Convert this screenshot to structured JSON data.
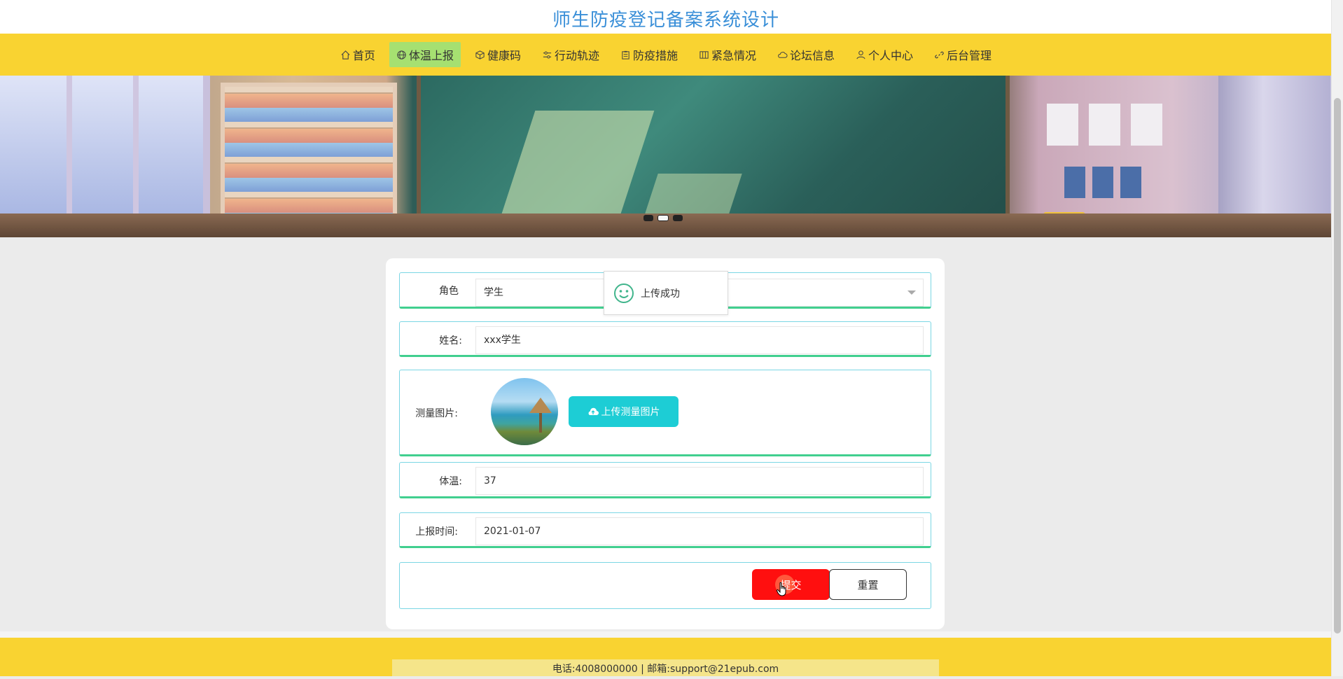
{
  "site": {
    "title": "师生防疫登记备案系统设计"
  },
  "nav": {
    "items": [
      {
        "label": "首页",
        "icon": "home-icon"
      },
      {
        "label": "体温上报",
        "icon": "globe-icon"
      },
      {
        "label": "健康码",
        "icon": "cube-icon"
      },
      {
        "label": "行动轨迹",
        "icon": "sliders-icon"
      },
      {
        "label": "防疫措施",
        "icon": "clipboard-icon"
      },
      {
        "label": "紧急情况",
        "icon": "grid-icon"
      },
      {
        "label": "论坛信息",
        "icon": "cloud-icon"
      },
      {
        "label": "个人中心",
        "icon": "user-icon"
      },
      {
        "label": "后台管理",
        "icon": "link-icon"
      }
    ],
    "active_index": 1
  },
  "banner": {
    "slides": 3,
    "active_slide": 1
  },
  "toast": {
    "message": "上传成功",
    "icon": "smile-icon"
  },
  "form": {
    "role": {
      "label": "角色",
      "value": "学生"
    },
    "name": {
      "label": "姓名:",
      "value": "xxx学生"
    },
    "image": {
      "label": "测量图片:",
      "upload_label": "上传测量图片",
      "upload_icon": "cloud-upload-icon"
    },
    "temperature": {
      "label": "体温:",
      "value": "37"
    },
    "report_time": {
      "label": "上报时间:",
      "value": "2021-01-07"
    },
    "submit_label": "提交",
    "reset_label": "重置"
  },
  "footer": {
    "contact": "电话:4008000000 | 邮箱:support@21epub.com"
  },
  "colors": {
    "nav_bg": "#f9d331",
    "active_nav": "#a6e071",
    "title": "#3a8fd8",
    "submit": "#ff0f0f",
    "upload": "#1dcdd5"
  }
}
